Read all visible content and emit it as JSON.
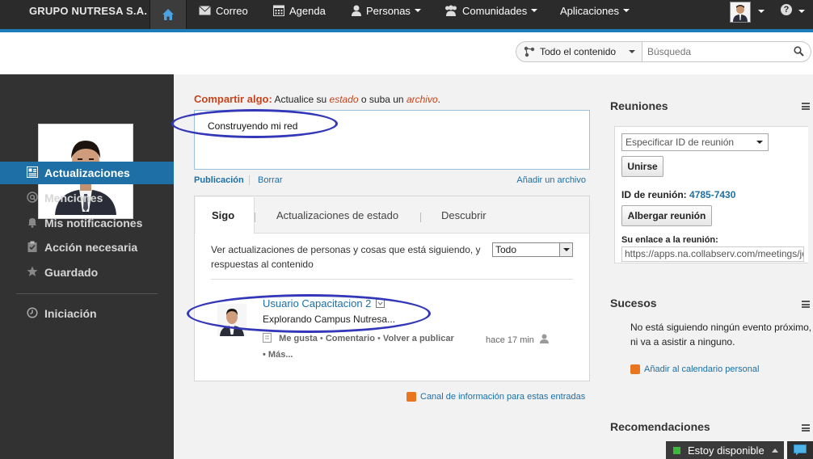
{
  "topbar": {
    "brand": "GRUPO NUTRESA S.A.",
    "nav": [
      {
        "label": "Correo",
        "icon": "mail-icon"
      },
      {
        "label": "Agenda",
        "icon": "calendar-icon"
      },
      {
        "label": "Personas",
        "icon": "person-icon"
      },
      {
        "label": "Comunidades",
        "icon": "communities-icon"
      },
      {
        "label": "Aplicaciones",
        "icon": "apps-icon"
      }
    ],
    "help": "?"
  },
  "search": {
    "scope": "Todo el contenido",
    "placeholder": "Búsqueda"
  },
  "sidebar": {
    "items": [
      {
        "label": "Actualizaciones",
        "icon": "updates-icon",
        "active": true
      },
      {
        "label": "Menciones",
        "icon": "at-icon"
      },
      {
        "label": "Mis notificaciones",
        "icon": "bell-icon"
      },
      {
        "label": "Acción necesaria",
        "icon": "clipboard-icon"
      },
      {
        "label": "Guardado",
        "icon": "star-icon"
      },
      {
        "label": "Iniciación",
        "icon": "clock-icon"
      }
    ]
  },
  "share": {
    "title": "Compartir algo:",
    "text1": " Actualice su ",
    "estado": "estado",
    "text2": " o suba un ",
    "archivo": "archivo",
    "text3": ".",
    "value": "Construyendo mi red",
    "post_label": "Publicación",
    "clear_label": "Borrar",
    "add_file_label": "Añadir un archivo"
  },
  "feed": {
    "tabs": [
      "Sigo",
      "Actualizaciones de estado",
      "Descubrir"
    ],
    "description": "Ver actualizaciones de personas y cosas que está siguiendo, y respuestas al contenido",
    "filter": "Todo",
    "post": {
      "user": "Usuario Capacitacion 2",
      "text": "Explorando Campus Nutresa...",
      "like": "Me gusta",
      "comment": "Comentario",
      "repost": "Volver a publicar",
      "time": "hace 17 min",
      "more": "Más..."
    },
    "rss_label": "Canal de información para estas entradas"
  },
  "meetings": {
    "title": "Reuniones",
    "select_placeholder": "Especificar ID de reunión",
    "join_label": "Unirse",
    "id_label": "ID de reunión:",
    "id_value": "4785-7430",
    "host_label": "Albergar reunión",
    "link_label": "Su enlace a la reunión:",
    "link_value": "https://apps.na.collabserv.com/meetings/jo"
  },
  "events": {
    "title": "Sucesos",
    "text": "No está siguiendo ningún evento próximo, ni va a asistir a ninguno.",
    "calendar_link": "Añadir al calendario personal"
  },
  "recommendations": {
    "title": "Recomendaciones"
  },
  "chat": {
    "status": "Estoy disponible"
  },
  "colors": {
    "accent": "#1d6fa5",
    "topbar": "#2b2b2b",
    "annotation": "#3337b8",
    "share_title": "#c5441c"
  }
}
